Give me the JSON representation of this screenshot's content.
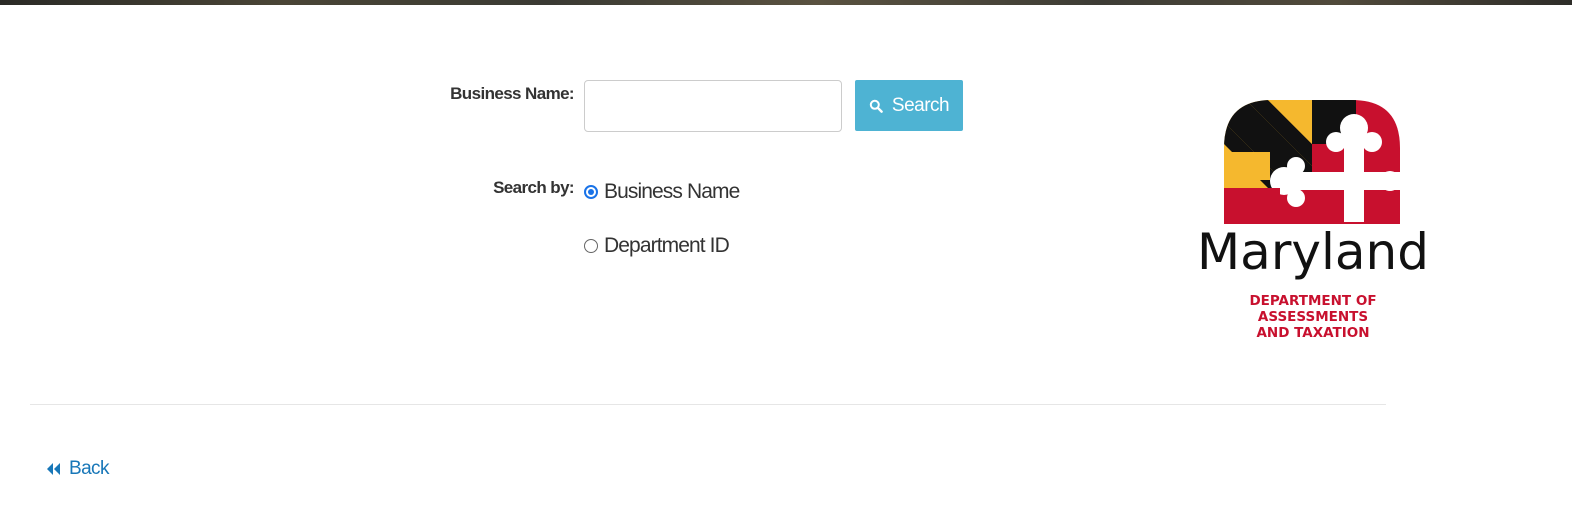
{
  "form": {
    "business_name_label": "Business Name:",
    "business_name_value": "",
    "search_button_label": "Search",
    "search_by_label": "Search by:",
    "options": [
      {
        "label": "Business Name",
        "selected": true
      },
      {
        "label": "Department ID",
        "selected": false
      }
    ]
  },
  "navigation": {
    "back_label": "Back"
  },
  "logo": {
    "wordmark": "Maryland",
    "subtitle_lines": [
      "DEPARTMENT OF",
      "ASSESSMENTS",
      "AND TAXATION"
    ]
  },
  "colors": {
    "search_button": "#4eb3d3",
    "link": "#1877b8",
    "radio_selected": "#1a73e8",
    "flag_gold": "#f5b82e",
    "flag_black": "#111111",
    "flag_red": "#c8102e",
    "logo_subtitle": "#c8102e"
  },
  "icons": {
    "search": "magnifier-icon",
    "back": "double-chevron-left-icon"
  }
}
